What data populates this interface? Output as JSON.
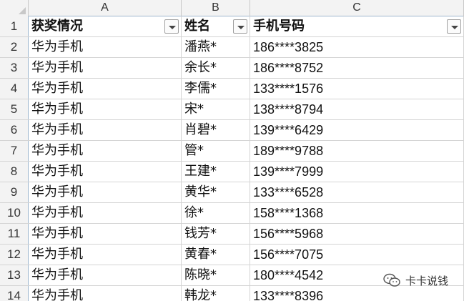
{
  "columns": [
    "A",
    "B",
    "C"
  ],
  "header": {
    "row_number": "1",
    "award": "获奖情况",
    "name": "姓名",
    "phone": "手机号码"
  },
  "rows": [
    {
      "n": "2",
      "award": "华为手机",
      "name": "潘燕*",
      "phone": "186****3825"
    },
    {
      "n": "3",
      "award": "华为手机",
      "name": "余长*",
      "phone": "186****8752"
    },
    {
      "n": "4",
      "award": "华为手机",
      "name": "李儒*",
      "phone": "133****1576"
    },
    {
      "n": "5",
      "award": "华为手机",
      "name": "宋*",
      "phone": "138****8794"
    },
    {
      "n": "6",
      "award": "华为手机",
      "name": "肖碧*",
      "phone": "139****6429"
    },
    {
      "n": "7",
      "award": "华为手机",
      "name": "管*",
      "phone": "189****9788"
    },
    {
      "n": "8",
      "award": "华为手机",
      "name": "王建*",
      "phone": "139****7999"
    },
    {
      "n": "9",
      "award": "华为手机",
      "name": "黄华*",
      "phone": "133****6528"
    },
    {
      "n": "10",
      "award": "华为手机",
      "name": "徐*",
      "phone": "158****1368"
    },
    {
      "n": "11",
      "award": "华为手机",
      "name": "钱芳*",
      "phone": "156****5968"
    },
    {
      "n": "12",
      "award": "华为手机",
      "name": "黄春*",
      "phone": "156****7075"
    },
    {
      "n": "13",
      "award": "华为手机",
      "name": "陈晓*",
      "phone": "180****4542"
    },
    {
      "n": "14",
      "award": "华为手机",
      "name": "韩龙*",
      "phone": "133****8396"
    }
  ],
  "watermark": {
    "text": "卡卡说钱",
    "icon": "wechat-icon"
  }
}
